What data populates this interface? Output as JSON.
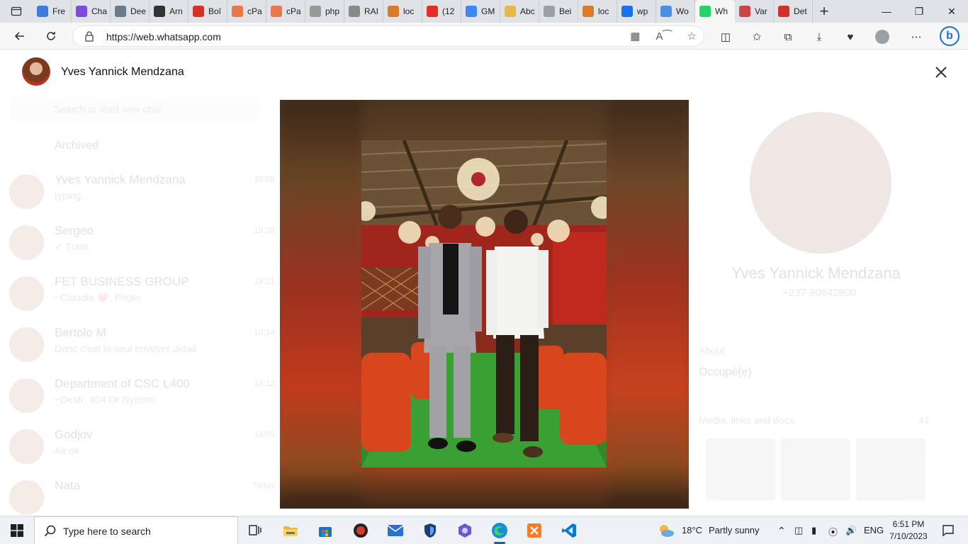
{
  "browser": {
    "tabs": [
      {
        "label": "Fre",
        "favicon": "tm",
        "color": "#3b7dd8"
      },
      {
        "label": "Cha",
        "favicon": "discord-icon",
        "color": "#7b4dd8"
      },
      {
        "label": "Dee",
        "favicon": "deepl-icon",
        "color": "#6c7b8b"
      },
      {
        "label": "Arn",
        "favicon": "github-icon",
        "color": "#333333"
      },
      {
        "label": "Boî",
        "favicon": "gmail-icon",
        "color": "#d93025"
      },
      {
        "label": "cPa",
        "favicon": "cpanel-icon",
        "color": "#e9774a"
      },
      {
        "label": "cPa",
        "favicon": "cpanel-icon",
        "color": "#e9774a"
      },
      {
        "label": "php",
        "favicon": "phpmyadmin-icon",
        "color": "#999999"
      },
      {
        "label": "RAI",
        "favicon": "cloud-icon",
        "color": "#8a8a8a"
      },
      {
        "label": "loc",
        "favicon": "phpmyadmin-icon",
        "color": "#d97b2b"
      },
      {
        "label": "(12",
        "favicon": "youtube-icon",
        "color": "#e52d27"
      },
      {
        "label": "GM",
        "favicon": "google-icon",
        "color": "#4285f4"
      },
      {
        "label": "Abc",
        "favicon": "coin-icon",
        "color": "#e6b94a"
      },
      {
        "label": "Bei",
        "favicon": "doc-icon",
        "color": "#9aa0a6"
      },
      {
        "label": "loc",
        "favicon": "phpmyadmin-icon",
        "color": "#d97b2b"
      },
      {
        "label": "wp",
        "favicon": "search-icon",
        "color": "#1a73e8"
      },
      {
        "label": "Wo",
        "favicon": "td",
        "color": "#4a90e2"
      },
      {
        "label": "Wh",
        "favicon": "whatsapp-icon",
        "color": "#25d366",
        "active": true
      },
      {
        "label": "Var",
        "favicon": "flag-icon",
        "color": "#c44"
      },
      {
        "label": "Det",
        "favicon": "d-icon",
        "color": "#d32f2f"
      }
    ],
    "url": "https://web.whatsapp.com"
  },
  "whatsapp": {
    "search_placeholder": "Search or start new chat",
    "archived_label": "Archived",
    "chats": [
      {
        "name": "Yves Yannick Mendzana",
        "preview": "typing...",
        "time": "19:06"
      },
      {
        "name": "Sergeo",
        "preview": "✓ Trant",
        "time": "18:28"
      },
      {
        "name": "FET BUSINESS GROUP",
        "preview": "~Claudia 💗: Photo",
        "time": "18:21"
      },
      {
        "name": "Bertolo M",
        "preview": "Donc c'est le seul envoyer detail",
        "time": "18:14"
      },
      {
        "name": "Department of CSC L400",
        "preview": "~Desfr: 404 Dr Nyamsi",
        "time": "18:12"
      },
      {
        "name": "Godjov",
        "preview": "Ak ok",
        "time": "18:05"
      },
      {
        "name": "Nata",
        "preview": "",
        "time": "Today"
      }
    ],
    "profile": {
      "name": "Yves Yannick Mendzana",
      "phone": "+237 90642800",
      "about_label": "About",
      "about_value": "Occupé(e)",
      "media_label": "Media, links and docs",
      "media_count": "41"
    }
  },
  "viewer": {
    "contact_name": "Yves Yannick Mendzana"
  },
  "taskbar": {
    "search_text": "Type here to search",
    "weather_temp": "18°C",
    "weather_desc": "Partly sunny",
    "language": "ENG",
    "time": "6:51 PM",
    "date": "7/10/2023"
  }
}
